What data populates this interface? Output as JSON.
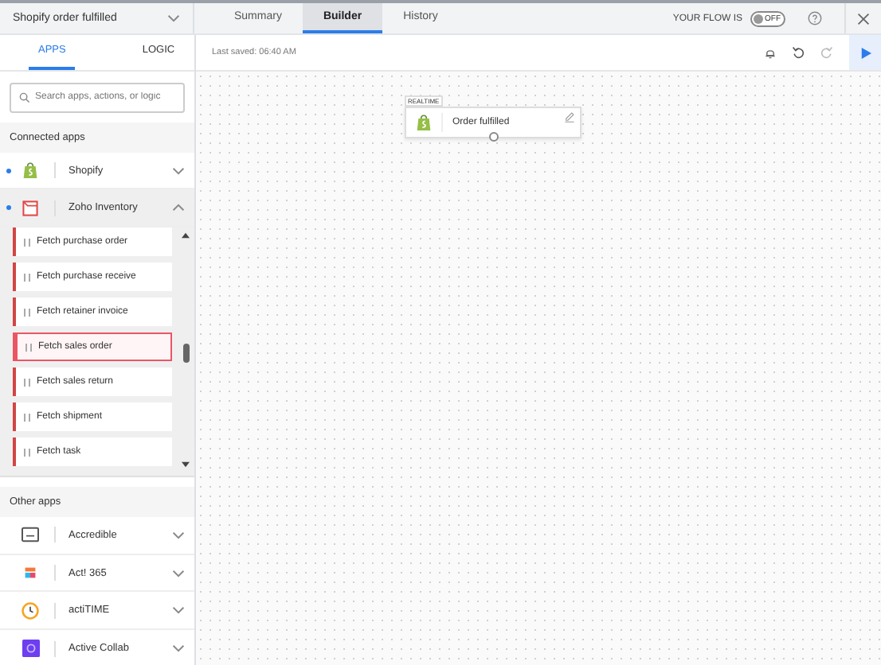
{
  "flow": {
    "name": "Shopify order fulfilled",
    "tabs": [
      {
        "label": "Summary",
        "selected": false
      },
      {
        "label": "Builder",
        "selected": true
      },
      {
        "label": "History",
        "selected": false
      }
    ],
    "status_label": "YOUR FLOW IS",
    "toggle": {
      "label": "OFF",
      "on": false
    }
  },
  "sidebar": {
    "tabs": [
      {
        "label": "APPS",
        "selected": true
      },
      {
        "label": "LOGIC",
        "selected": false
      }
    ],
    "search": {
      "placeholder": "Search apps, actions, or logic"
    },
    "connected_heading": "Connected apps",
    "connected_apps": [
      {
        "name": "Shopify",
        "kind": "shopify",
        "expanded": false,
        "connected": true
      },
      {
        "name": "Zoho Inventory",
        "kind": "zoho",
        "expanded": true,
        "connected": true
      }
    ],
    "actions": [
      {
        "label": "Fetch purchase order",
        "selected": false
      },
      {
        "label": "Fetch purchase receive",
        "selected": false
      },
      {
        "label": "Fetch retainer invoice",
        "selected": false
      },
      {
        "label": "Fetch sales order",
        "selected": true
      },
      {
        "label": "Fetch sales return",
        "selected": false
      },
      {
        "label": "Fetch shipment",
        "selected": false
      },
      {
        "label": "Fetch task",
        "selected": false
      }
    ],
    "other_heading": "Other apps",
    "other_apps": [
      {
        "name": "Accredible",
        "kind": "accredible"
      },
      {
        "name": "Act! 365",
        "kind": "act"
      },
      {
        "name": "actiTIME",
        "kind": "actitime"
      },
      {
        "name": "Active Collab",
        "kind": "activecollab"
      }
    ]
  },
  "toolbar": {
    "last_saved": "Last saved: 06:40 AM"
  },
  "canvas": {
    "trigger": {
      "badge": "REALTIME",
      "label": "Order fulfilled"
    }
  }
}
